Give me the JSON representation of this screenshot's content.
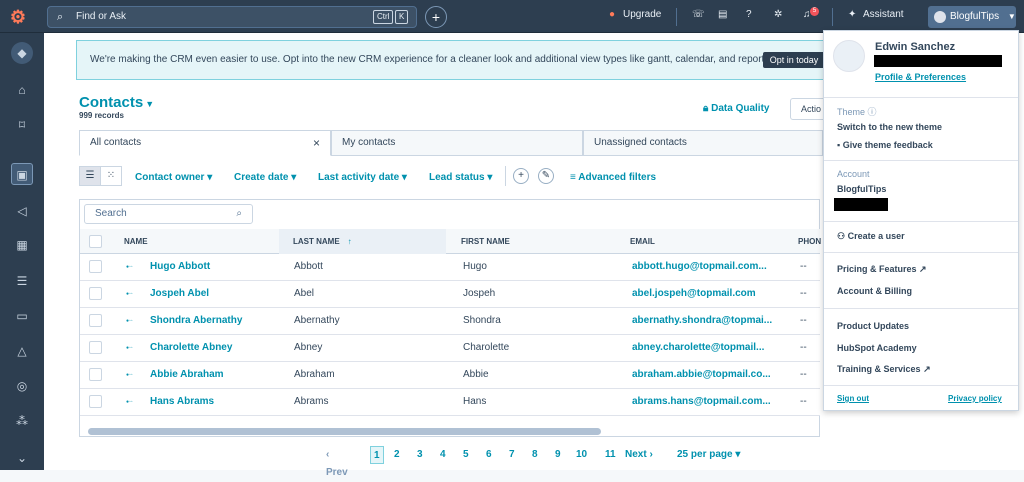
{
  "topbar": {
    "search_placeholder": "Find or Ask",
    "kbd1": "Ctrl",
    "kbd2": "K",
    "upgrade": "Upgrade",
    "assistant": "Assistant",
    "account": "BlogfulTips",
    "notification_count": "5"
  },
  "banner": {
    "text": "We're making the CRM even easier to use. Opt into the new CRM experience for a cleaner look and additional view types like gantt, calendar, and report.",
    "button": "Opt in today"
  },
  "page": {
    "title": "Contacts",
    "records": "999 records",
    "data_quality": "Data Quality",
    "actions": "Actio"
  },
  "tabs": [
    "All contacts",
    "My contacts",
    "Unassigned contacts"
  ],
  "filters": [
    "Contact owner",
    "Create date",
    "Last activity date",
    "Lead status"
  ],
  "advanced_filters": "Advanced filters",
  "table": {
    "search_placeholder": "Search",
    "headers": {
      "name": "NAME",
      "last_name": "LAST NAME",
      "first_name": "FIRST NAME",
      "email": "EMAIL",
      "phone": "PHON"
    },
    "rows": [
      {
        "name": "Hugo Abbott",
        "last": "Abbott",
        "first": "Hugo",
        "email": "abbott.hugo@topmail.com...",
        "phone": "--"
      },
      {
        "name": "Jospeh Abel",
        "last": "Abel",
        "first": "Jospeh",
        "email": "abel.jospeh@topmail.com",
        "phone": "--"
      },
      {
        "name": "Shondra Abernathy",
        "last": "Abernathy",
        "first": "Shondra",
        "email": "abernathy.shondra@topmai...",
        "phone": "--"
      },
      {
        "name": "Charolette Abney",
        "last": "Abney",
        "first": "Charolette",
        "email": "abney.charolette@topmail...",
        "phone": "--"
      },
      {
        "name": "Abbie Abraham",
        "last": "Abraham",
        "first": "Abbie",
        "email": "abraham.abbie@topmail.co...",
        "phone": "--"
      },
      {
        "name": "Hans Abrams",
        "last": "Abrams",
        "first": "Hans",
        "email": "abrams.hans@topmail.com...",
        "phone": "--"
      }
    ]
  },
  "pager": {
    "prev": "Prev",
    "pages": [
      "1",
      "2",
      "3",
      "4",
      "5",
      "6",
      "7",
      "8",
      "9",
      "10",
      "11"
    ],
    "next": "Next",
    "per_page": "25 per page"
  },
  "dropdown": {
    "user_name": "Edwin Sanchez",
    "profile_link": "Profile & Preferences",
    "theme_header": "Theme",
    "switch_theme": "Switch to the new theme",
    "give_feedback": "Give theme feedback",
    "account_header": "Account",
    "account_name": "BlogfulTips",
    "create_user": "Create a user",
    "pricing": "Pricing & Features",
    "billing": "Account & Billing",
    "product_updates": "Product Updates",
    "academy": "HubSpot Academy",
    "training": "Training & Services",
    "sign_out": "Sign out",
    "privacy": "Privacy policy"
  }
}
